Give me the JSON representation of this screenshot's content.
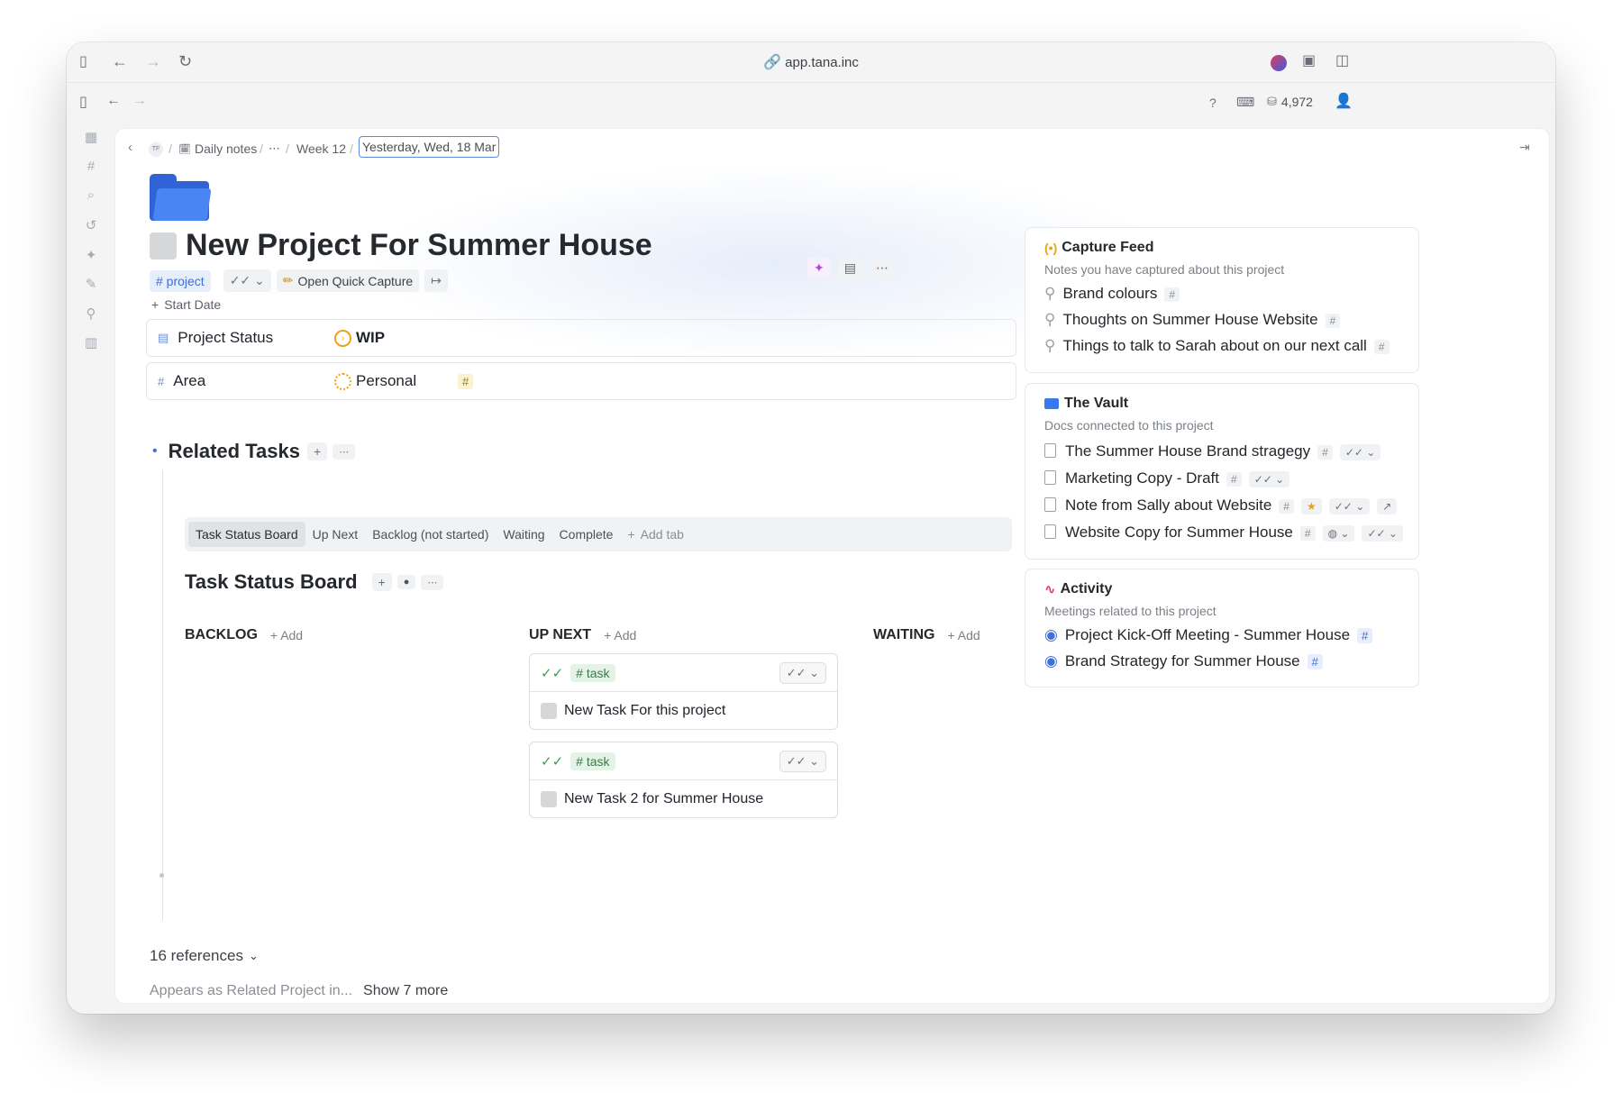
{
  "browser": {
    "url": "app.tana.inc"
  },
  "app_bar": {
    "credits": "4,972"
  },
  "breadcrumb": {
    "workspace_initials": "TF",
    "daily_notes": "Daily notes",
    "week": "Week 12",
    "date": "Yesterday, Wed, 18 Mar"
  },
  "page": {
    "title": "New Project For Summer House",
    "tag": "# project",
    "quick_capture": "Open Quick Capture",
    "start_date": "Start Date",
    "fields": [
      {
        "name": "Project Status",
        "value": "WIP"
      },
      {
        "name": "Area",
        "value": "Personal",
        "value_tag": "#"
      }
    ]
  },
  "related_tasks": {
    "heading": "Related Tasks",
    "tabs": [
      "Task Status Board",
      "Up Next",
      "Backlog (not started)",
      "Waiting",
      "Complete"
    ],
    "add_tab": "Add tab",
    "board_title": "Task Status Board",
    "columns": [
      {
        "name": "BACKLOG",
        "add": "Add"
      },
      {
        "name": "UP NEXT",
        "add": "Add"
      },
      {
        "name": "WAITING",
        "add": "Add"
      }
    ],
    "cards": [
      {
        "tag": "# task",
        "title": "New Task For this project"
      },
      {
        "tag": "# task",
        "title": "New Task 2 for Summer House"
      }
    ]
  },
  "references": {
    "count_label": "16 references",
    "appears_as": "Appears as Related Project in...",
    "show_more": "Show 7 more"
  },
  "capture_feed": {
    "title": "Capture Feed",
    "subtitle": "Notes you have captured about this project",
    "items": [
      "Brand colours",
      "Thoughts on Summer House Website",
      "Things to talk to Sarah about on our next call"
    ]
  },
  "vault": {
    "title": "The Vault",
    "subtitle": "Docs connected to this project",
    "items": [
      "The Summer House Brand stragegy",
      "Marketing Copy - Draft",
      "Note from Sally about Website",
      "Website Copy for Summer House"
    ]
  },
  "activity": {
    "title": "Activity",
    "subtitle": "Meetings related to this project",
    "items": [
      "Project Kick-Off Meeting - Summer House",
      "Brand Strategy for Summer House"
    ]
  },
  "colors": {
    "accent": "#3f6fd8",
    "folder": "#3b78f0",
    "wip": "#e8a317",
    "activity": "#e0365a"
  }
}
